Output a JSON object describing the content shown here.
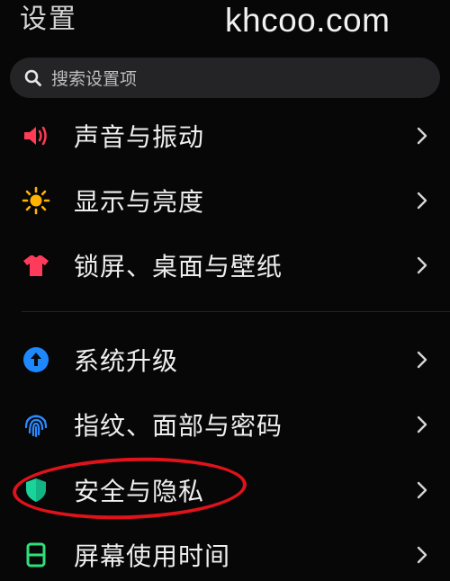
{
  "header": {
    "title": "设置"
  },
  "watermark": "khcoo.com",
  "search": {
    "placeholder": "搜索设置项",
    "icon": "search-icon"
  },
  "items": [
    {
      "label": "声音与振动",
      "icon": "speaker-icon",
      "color": "#ff3b56"
    },
    {
      "label": "显示与亮度",
      "icon": "sun-icon",
      "color": "#ffb300"
    },
    {
      "label": "锁屏、桌面与壁纸",
      "icon": "tshirt-icon",
      "color": "#ff3b5c"
    },
    {
      "label": "系统升级",
      "icon": "upgrade-arrow-icon",
      "color": "#1e88ff"
    },
    {
      "label": "指纹、面部与密码",
      "icon": "fingerprint-icon",
      "color": "#2a8bff"
    },
    {
      "label": "安全与隐私",
      "icon": "shield-icon",
      "color": "#19d39a"
    },
    {
      "label": "屏幕使用时间",
      "icon": "hourglass-icon",
      "color": "#2fe07a"
    }
  ],
  "annotation": {
    "shape": "red-oval",
    "target": "安全与隐私",
    "color": "#e0121a"
  }
}
